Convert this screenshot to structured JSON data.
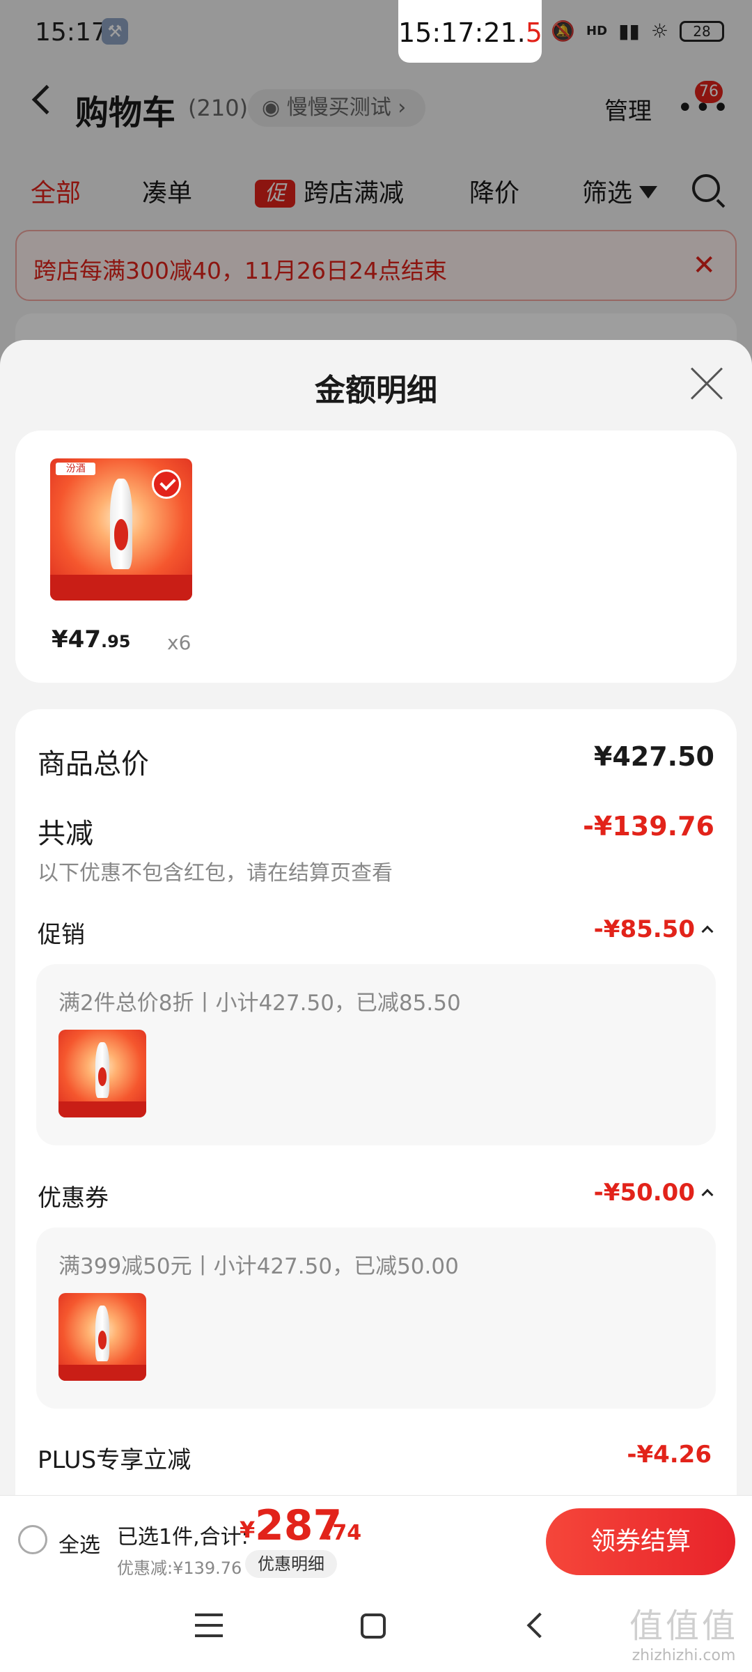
{
  "status_bar": {
    "time": "15:17",
    "clock_main": "15:17:21.",
    "clock_red": "5",
    "battery": "28",
    "hd": "HD"
  },
  "nav": {
    "title": "购物车",
    "count": "(210)",
    "chip": "慢慢买测试 ›",
    "manage": "管理",
    "badge": "76"
  },
  "tabs": {
    "all": "全部",
    "bundle": "凑单",
    "promo_tag": "促",
    "cross_store": "跨店满减",
    "price_drop": "降价",
    "filter": "筛选"
  },
  "banner": {
    "text": "跨店每满300减40，11月26日24点结束"
  },
  "sheet": {
    "title": "金额明细",
    "item": {
      "price_main": "¥47",
      "price_small": ".95",
      "qty": "x6",
      "logo": "汾酒"
    },
    "details": {
      "goods_total_label": "商品总价",
      "goods_total_value": "¥427.50",
      "total_off_label": "共减",
      "total_off_value": "-¥139.76",
      "note": "以下优惠不包含红包，请在结算页查看",
      "promo_label": "促销",
      "promo_value": "-¥85.50",
      "promo_desc": "满2件总价8折丨小计427.50，已减85.50",
      "coupon_label": "优惠券",
      "coupon_value": "-¥50.00",
      "coupon_desc": "满399减50元丨小计427.50，已减50.00",
      "plus_label": "PLUS专享立减",
      "plus_value": "-¥4.26"
    }
  },
  "bottom_bar": {
    "select_all": "全选",
    "total_label": "已选1件,合计:",
    "currency": "¥",
    "total_int": "287",
    "total_dec": ".74",
    "saved": "优惠减:¥139.76",
    "details_link": "优惠明细",
    "checkout": "领券结算"
  },
  "watermark": {
    "big": "值值值",
    "small": "zhizhizhi.com"
  }
}
